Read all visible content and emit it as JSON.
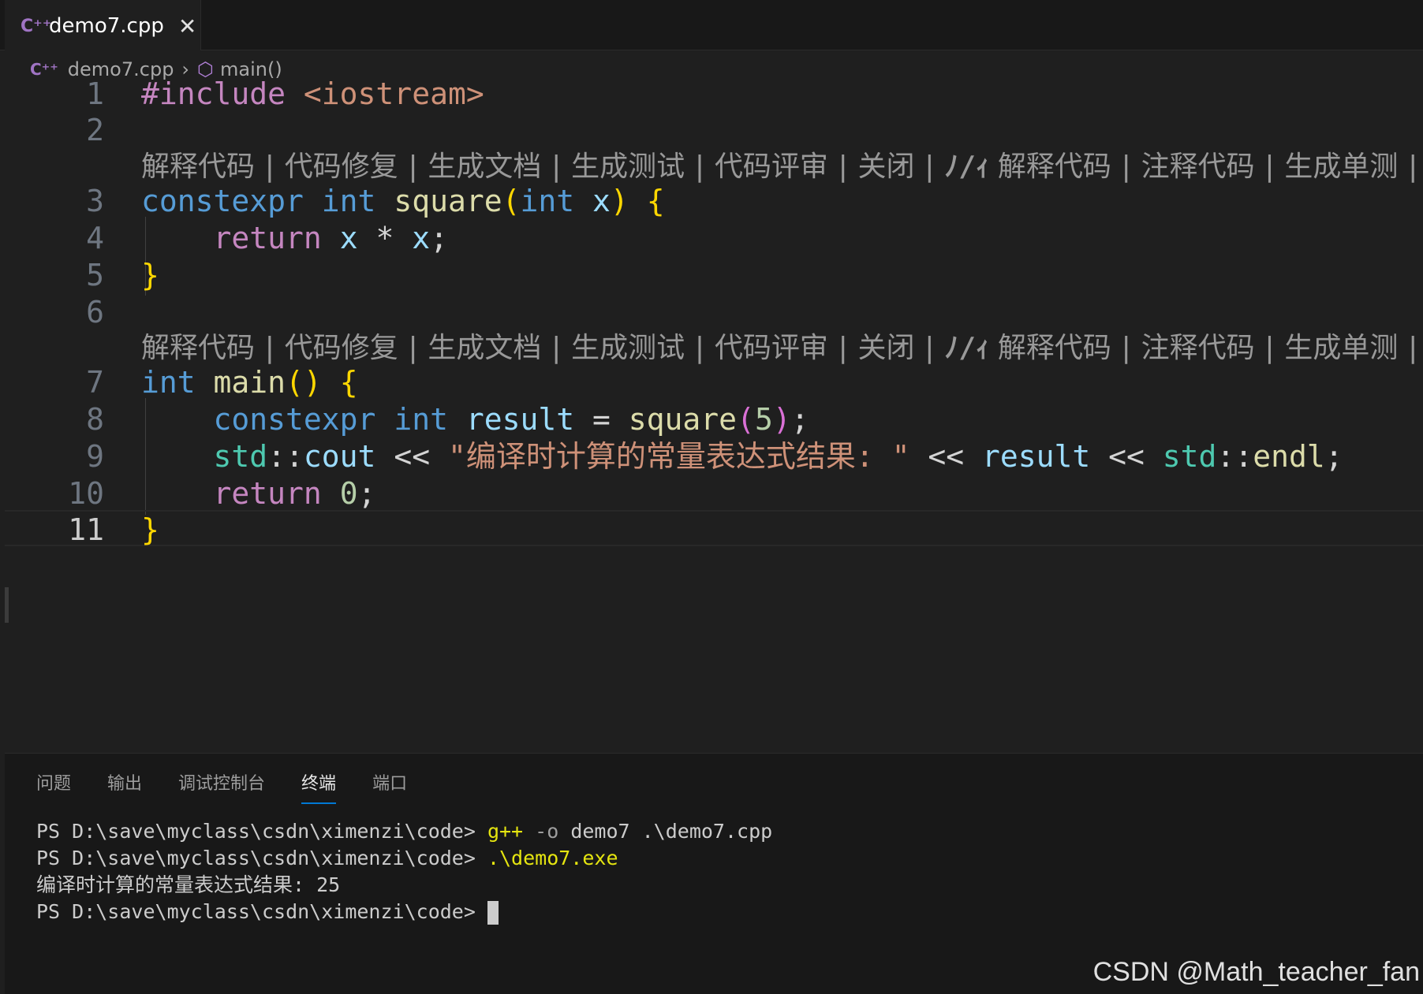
{
  "tab": {
    "label": "demo7.cpp",
    "icon": "cpp-icon",
    "close": "✕"
  },
  "breadcrumb": {
    "file": "demo7.cpp",
    "symbol": "main()"
  },
  "lens": {
    "items": [
      "解释代码",
      "代码修复",
      "生成文档",
      "生成测试",
      "代码评审",
      "关闭"
    ],
    "ai_items": [
      "解释代码",
      "注释代码",
      "生成单测"
    ],
    "close": "✕"
  },
  "line_numbers": [
    "1",
    "2",
    "3",
    "4",
    "5",
    "6",
    "7",
    "8",
    "9",
    "10",
    "11"
  ],
  "code": {
    "l1": [
      "#include",
      " ",
      "<iostream>"
    ],
    "l3": [
      "constexpr",
      " ",
      "int",
      " ",
      "square",
      "(",
      "int",
      " ",
      "x",
      ")",
      " ",
      "{"
    ],
    "l4": [
      "    ",
      "return",
      " ",
      "x",
      " * ",
      "x",
      ";"
    ],
    "l5": [
      "}"
    ],
    "l7": [
      "int",
      " ",
      "main",
      "()",
      " ",
      "{"
    ],
    "l8": [
      "    ",
      "constexpr",
      " ",
      "int",
      " ",
      "result",
      " = ",
      "square",
      "(",
      "5",
      ")",
      ";"
    ],
    "l9": [
      "    ",
      "std",
      "::",
      "cout",
      " << ",
      "\"编译时计算的常量表达式结果: \"",
      " << ",
      "result",
      " << ",
      "std",
      "::",
      "endl",
      ";"
    ],
    "l10": [
      "    ",
      "return",
      " ",
      "0",
      ";"
    ],
    "l11": [
      "}"
    ]
  },
  "panel": {
    "tabs": [
      "问题",
      "输出",
      "调试控制台",
      "终端",
      "端口"
    ],
    "active_tab": "终端"
  },
  "terminal": {
    "prompt": "PS D:\\save\\myclass\\csdn\\ximenzi\\code> ",
    "line1_cmd": "g++",
    "line1_flag": " -o",
    "line1_rest": " demo7 .\\demo7.cpp",
    "line2_cmd": ".\\demo7.exe",
    "line3": "编译时计算的常量表达式结果: 25"
  },
  "watermark": "CSDN @Math_teacher_fan"
}
